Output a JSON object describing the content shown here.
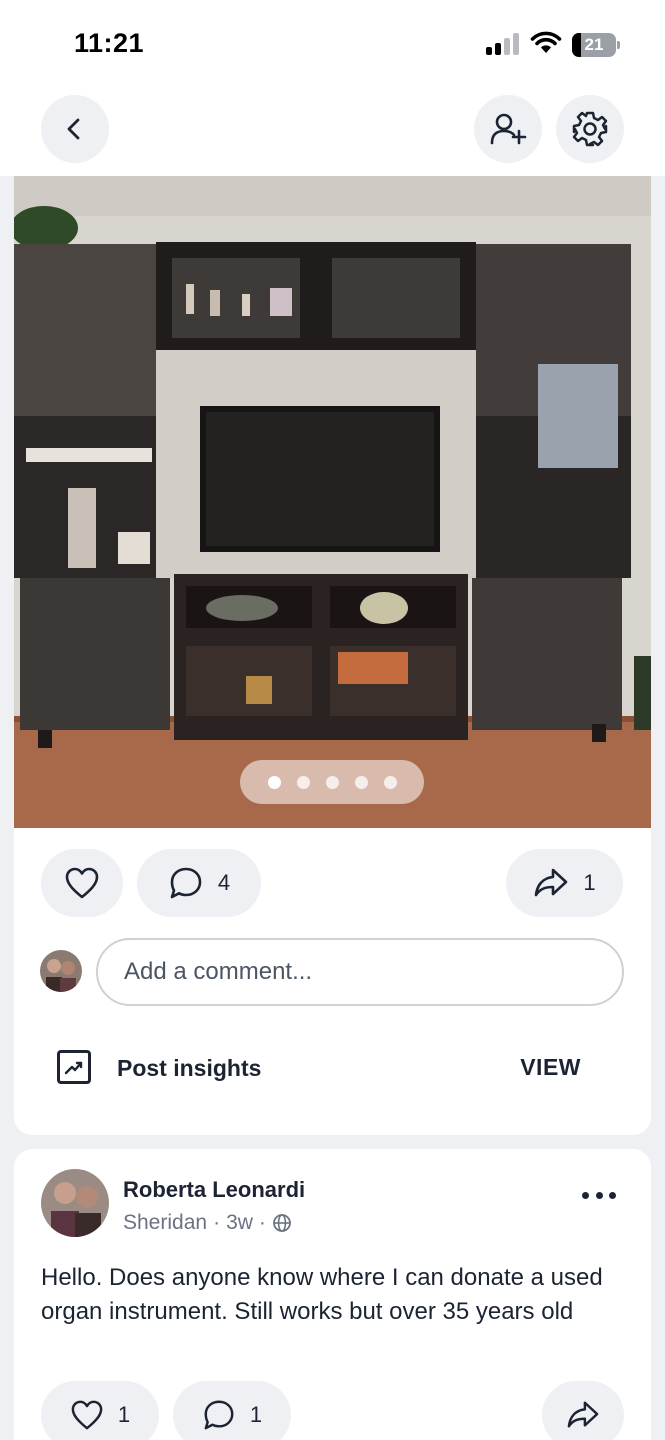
{
  "status_bar": {
    "time": "11:21",
    "battery": "21"
  },
  "topbar": {
    "back_icon": "chevron-left-icon",
    "add_friend_icon": "user-plus-icon",
    "settings_icon": "gear-icon"
  },
  "photo": {
    "carousel_count": 5,
    "active_index": 0
  },
  "actions": {
    "comment_count": "4",
    "share_count": "1"
  },
  "comment_box": {
    "placeholder": "Add a comment..."
  },
  "insights": {
    "label": "Post insights",
    "view": "VIEW"
  },
  "post": {
    "author": "Roberta Leonardi",
    "location": "Sheridan",
    "time_ago": "3w",
    "text": "Hello. Does anyone know where I can donate a used organ instrument.  Still works but over 35 years old",
    "like_count": "1",
    "comment_count": "1"
  },
  "colors": {
    "background": "#eef0f4",
    "card": "#ffffff",
    "text": "#1c2433",
    "muted": "#6b7280"
  }
}
